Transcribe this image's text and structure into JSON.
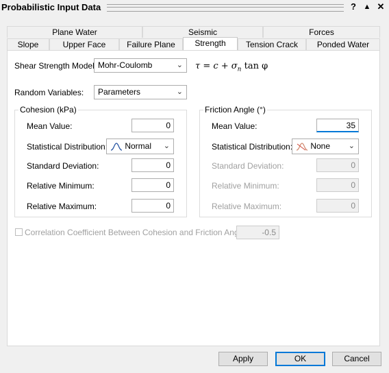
{
  "window": {
    "title": "Probabilistic Input Data",
    "help_label": "?",
    "pin_label": "▲",
    "close_label": "✕"
  },
  "tabs": {
    "back": [
      "Plane Water",
      "Seismic",
      "Forces"
    ],
    "front": [
      "Slope",
      "Upper Face",
      "Failure Plane",
      "Strength",
      "Tension Crack",
      "Ponded Water"
    ],
    "active": "Strength"
  },
  "strength": {
    "model_label": "Shear Strength Model:",
    "model_value": "Mohr-Coulomb",
    "formula": "τ = c + σ",
    "formula_sub": "n",
    "formula_tail": "tan φ",
    "random_label": "Random Variables:",
    "random_value": "Parameters"
  },
  "cohesion": {
    "legend": "Cohesion (kPa)",
    "mean_label": "Mean Value:",
    "mean_value": "0",
    "dist_label": "Statistical Distribution:",
    "dist_value": "Normal",
    "std_label": "Standard Deviation:",
    "std_value": "0",
    "relmin_label": "Relative Minimum:",
    "relmin_value": "0",
    "relmax_label": "Relative Maximum:",
    "relmax_value": "0"
  },
  "friction": {
    "legend": "Friction Angle (°)",
    "mean_label": "Mean Value:",
    "mean_value": "35",
    "dist_label": "Statistical Distribution:",
    "dist_value": "None",
    "std_label": "Standard Deviation:",
    "std_value": "0",
    "relmin_label": "Relative Minimum:",
    "relmin_value": "0",
    "relmax_label": "Relative Maximum:",
    "relmax_value": "0"
  },
  "correlation": {
    "label": "Correlation Coefficient Between Cohesion and Friction Angle:",
    "value": "-0.5",
    "checked": false
  },
  "buttons": {
    "apply": "Apply",
    "ok": "OK",
    "cancel": "Cancel"
  },
  "colors": {
    "focus": "#0078d7",
    "disabled_text": "#a0a0a0"
  }
}
